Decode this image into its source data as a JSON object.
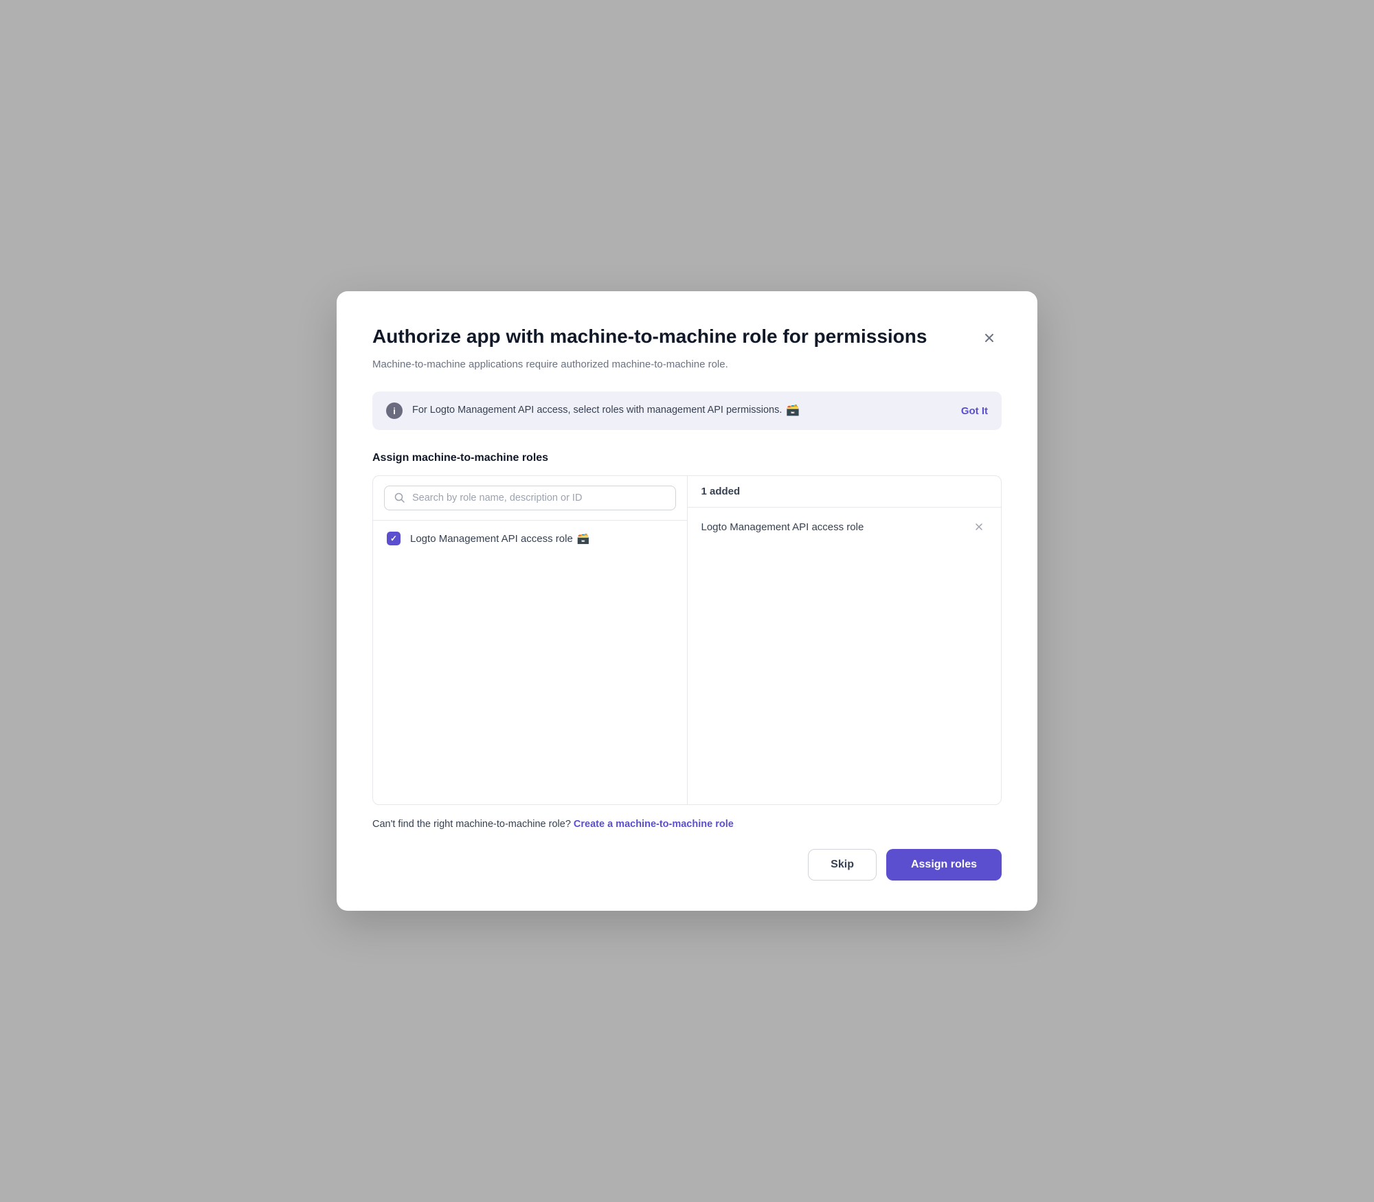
{
  "modal": {
    "title": "Authorize app with machine-to-machine role for permissions",
    "subtitle": "Machine-to-machine applications require authorized machine-to-machine role.",
    "close_label": "×"
  },
  "info_banner": {
    "icon_label": "i",
    "text": "For Logto Management API access, select roles with management API permissions.",
    "emoji": "🗃️",
    "got_it_label": "Got It"
  },
  "assign_section": {
    "label": "Assign machine-to-machine roles",
    "search_placeholder": "Search by role name, description or ID",
    "added_count": "1 added",
    "left_item": {
      "label": "Logto Management API access role",
      "emoji": "🗃️"
    },
    "right_item": {
      "label": "Logto Management API access role"
    }
  },
  "footer": {
    "text": "Can't find the right machine-to-machine role?",
    "link_text": "Create a machine-to-machine role"
  },
  "actions": {
    "skip_label": "Skip",
    "assign_label": "Assign roles"
  }
}
